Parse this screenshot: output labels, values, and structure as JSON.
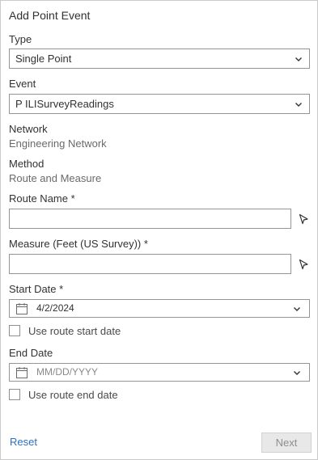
{
  "panel": {
    "title": "Add Point Event"
  },
  "type_field": {
    "label": "Type",
    "value": "Single Point"
  },
  "event_field": {
    "label": "Event",
    "value": "P ILISurveyReadings"
  },
  "network": {
    "label": "Network",
    "value": "Engineering Network"
  },
  "method": {
    "label": "Method",
    "value": "Route and Measure"
  },
  "route_name": {
    "label": "Route Name *",
    "value": ""
  },
  "measure": {
    "label": "Measure (Feet (US Survey)) *",
    "value": ""
  },
  "start_date": {
    "label": "Start Date *",
    "value": "4/2/2024",
    "checkbox_label": "Use route start date",
    "checked": false
  },
  "end_date": {
    "label": "End Date",
    "placeholder": "MM/DD/YYYY",
    "checkbox_label": "Use route end date",
    "checked": false
  },
  "footer": {
    "reset_label": "Reset",
    "next_label": "Next"
  },
  "icons": {
    "select_chevron": "chevron-down-icon",
    "map_picker": "cursor-arrow-icon",
    "calendar": "calendar-icon"
  },
  "colors": {
    "link": "#2b70c0",
    "border": "#959595",
    "disabled_bg": "#e8e8e8",
    "disabled_text": "#8d8d8d"
  }
}
